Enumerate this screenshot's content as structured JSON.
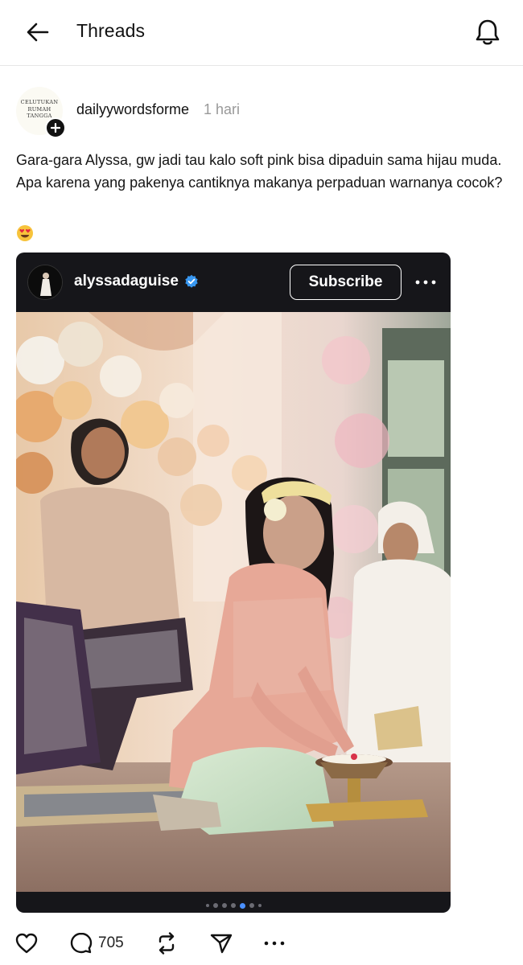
{
  "header": {
    "back_icon": "arrow-left-icon",
    "title": "Threads",
    "notification_icon": "bell-icon"
  },
  "post": {
    "author": {
      "avatar_text": "CELUTUKAN RUMAH TANGGA",
      "username": "dailyywordsforme",
      "time": "1 hari",
      "follow_icon": "plus-icon"
    },
    "caption": "Gara-gara Alyssa, gw jadi tau kalo soft pink bisa dipaduin sama hijau muda. Apa karena yang pakenya cantiknya makanya perpaduan warnanya cocok?",
    "emoji_icon": "heart-eyes-emoji-icon",
    "embed": {
      "username": "alyssadaguise",
      "verified_icon": "verified-badge-icon",
      "subscribe_label": "Subscribe",
      "more_icon": "more-horizontal-icon",
      "photo_alt": "photo",
      "carousel": {
        "count": 7,
        "active_index": 4
      }
    },
    "actions": {
      "like_icon": "heart-icon",
      "reply_icon": "comment-icon",
      "reply_count": "705",
      "repost_icon": "repost-icon",
      "share_icon": "send-icon",
      "more_icon": "more-horizontal-icon"
    }
  },
  "colors": {
    "card_background": "#16161a",
    "verified_blue": "#3897f0",
    "active_dot": "#4a90ff"
  }
}
